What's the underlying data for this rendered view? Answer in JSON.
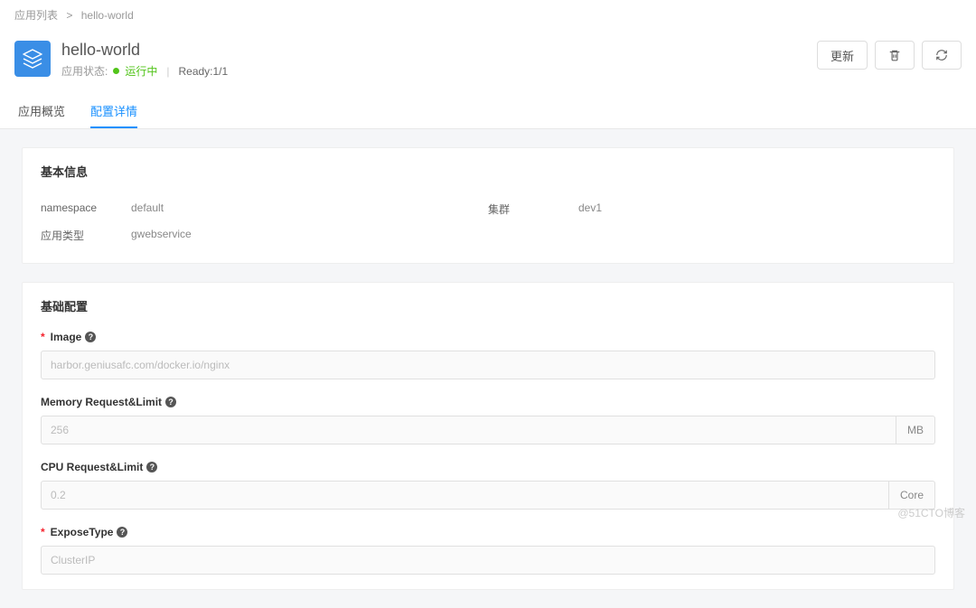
{
  "breadcrumb": {
    "root": "应用列表",
    "separator": ">",
    "current": "hello-world"
  },
  "header": {
    "app_name": "hello-world",
    "status_label": "应用状态:",
    "status_text": "运行中",
    "ready_text": "Ready:1/1",
    "update_label": "更新"
  },
  "tabs": {
    "overview": "应用概览",
    "config": "配置详情"
  },
  "basic_info": {
    "title": "基本信息",
    "rows": {
      "namespace_label": "namespace",
      "namespace_value": "default",
      "cluster_label": "集群",
      "cluster_value": "dev1",
      "app_type_label": "应用类型",
      "app_type_value": "gwebservice"
    }
  },
  "base_config": {
    "title": "基础配置",
    "image": {
      "label": "Image",
      "value": "harbor.geniusafc.com/docker.io/nginx"
    },
    "memory": {
      "label": "Memory Request&Limit",
      "value": "256",
      "unit": "MB"
    },
    "cpu": {
      "label": "CPU Request&Limit",
      "value": "0.2",
      "unit": "Core"
    },
    "expose": {
      "label": "ExposeType",
      "value": "ClusterIP"
    }
  },
  "watermark": "@51CTO博客"
}
